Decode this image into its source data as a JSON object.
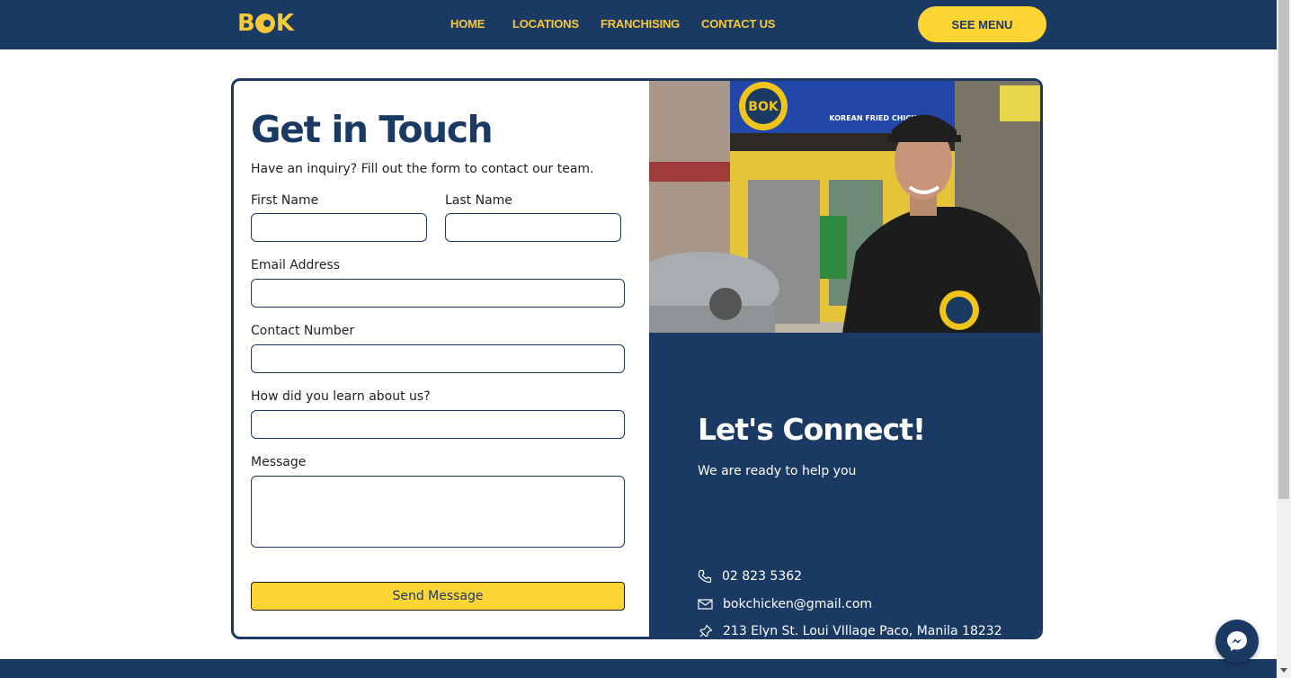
{
  "nav": {
    "logo_text": "BOK",
    "links": [
      "HOME",
      "LOCATIONS",
      "FRANCHISING",
      "CONTACT US"
    ],
    "cta_label": "SEE MENU"
  },
  "form": {
    "title": "Get in Touch",
    "subtitle": "Have an inquiry? Fill out the form to contact our team.",
    "first_name": {
      "label": "First Name",
      "value": "",
      "placeholder": ""
    },
    "last_name": {
      "label": "Last Name",
      "value": "",
      "placeholder": ""
    },
    "email": {
      "label": "Email Address",
      "value": "",
      "placeholder": ""
    },
    "contact_number": {
      "label": "Contact Number",
      "value": "",
      "placeholder": ""
    },
    "referral": {
      "label": "How did you learn about us?",
      "value": "",
      "placeholder": ""
    },
    "message": {
      "label": "Message",
      "value": "",
      "placeholder": ""
    },
    "submit_label": "Send Message"
  },
  "contact": {
    "title": "Let's Connect!",
    "subtitle": "We are ready to help you",
    "phone": "02 823 5362",
    "email": "bokchicken@gmail.com",
    "address": "213 Elyn St. Loui VIllage Paco, Manila 18232"
  },
  "photo": {
    "sign_text": "BOK",
    "sign_sub": "KOREAN FRIED CHICKEN",
    "alt_semantic": "store-front-staff-photo"
  },
  "icons": {
    "phone": "phone-icon",
    "mail": "mail-icon",
    "address": "pin-icon",
    "messenger": "messenger-icon"
  },
  "colors": {
    "navy": "#1b3a63",
    "yellow": "#fdd535",
    "nav_text": "#f7c93a"
  }
}
